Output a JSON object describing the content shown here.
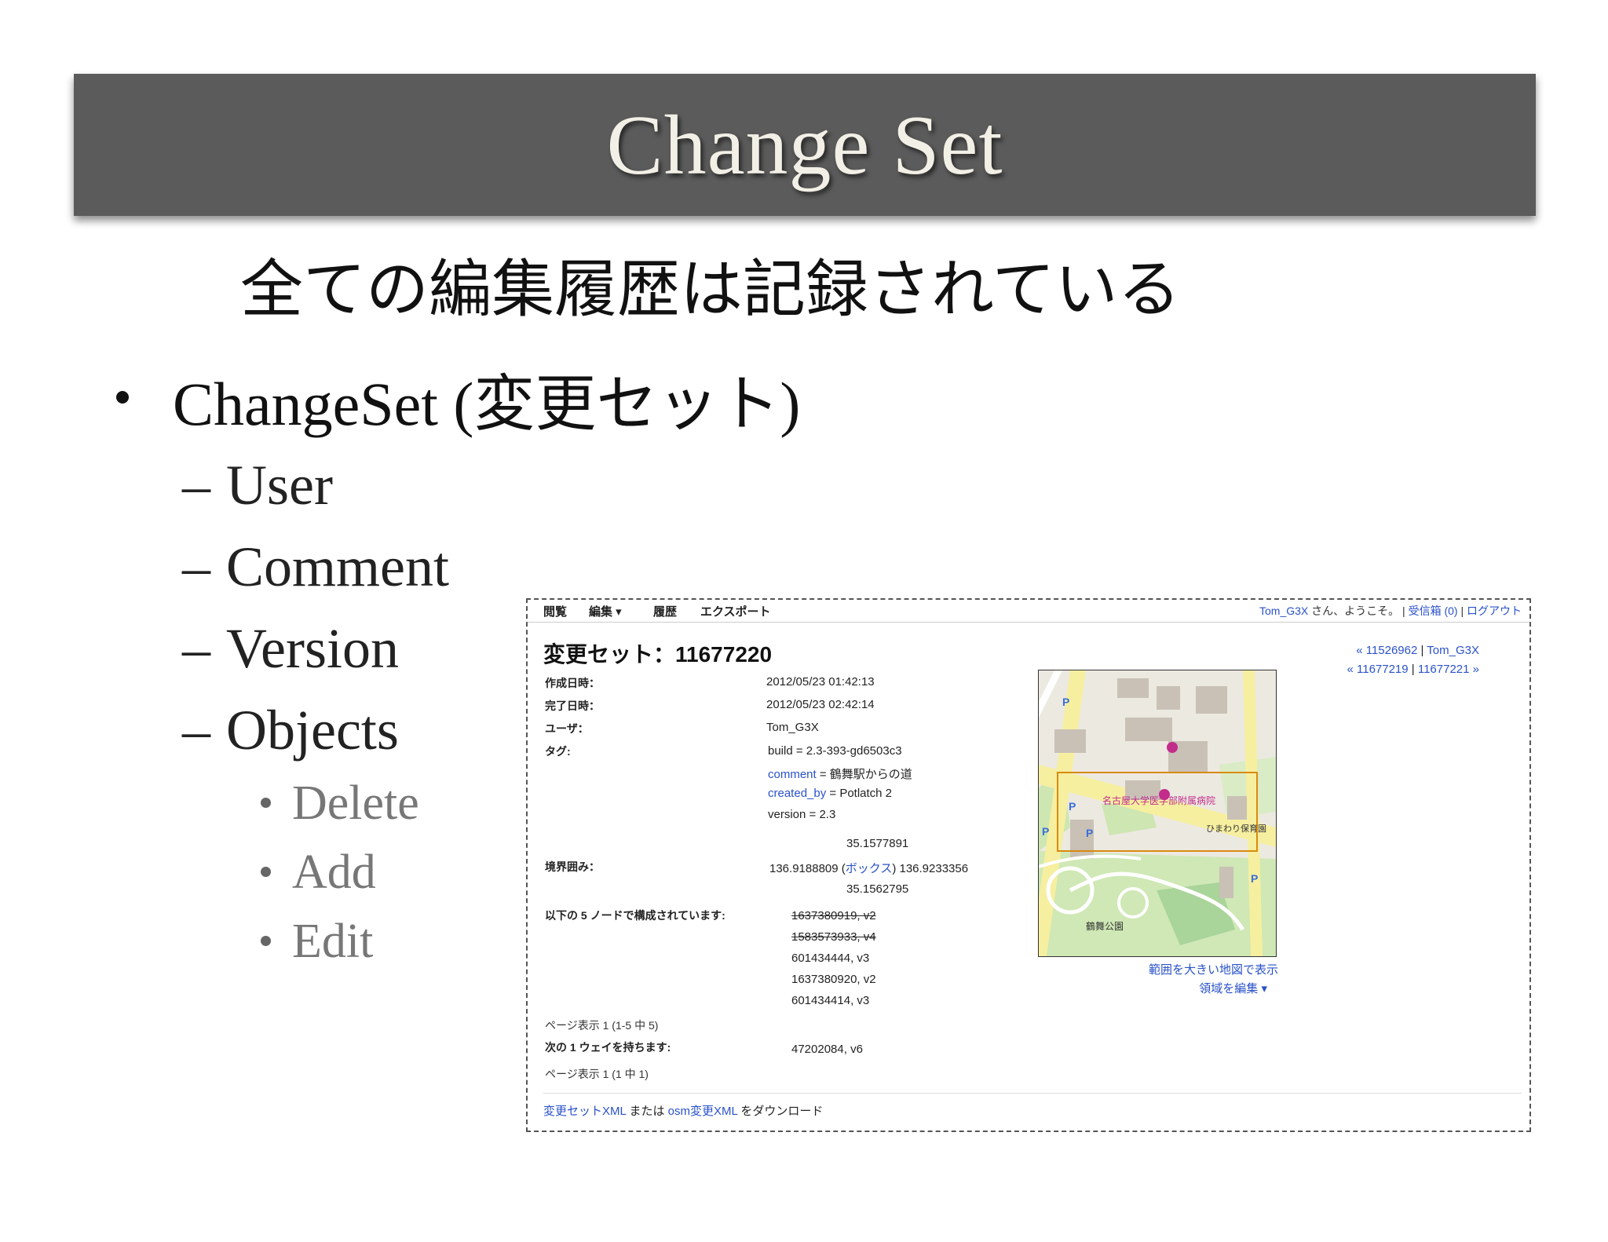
{
  "slide": {
    "title": "Change Set",
    "headline": "全ての編集履歴は記録されている",
    "bullet_main": "ChangeSet (変更セット)",
    "sub_items": [
      "User",
      "Comment",
      "Version",
      "Objects"
    ],
    "object_items": [
      "Delete",
      "Add",
      "Edit"
    ],
    "dash": "–"
  },
  "screenshot": {
    "nav": {
      "browse": "閲覧",
      "edit": "編集 ▾",
      "history": "履歴",
      "export": "エクスポート",
      "user_link": "Tom_G3X",
      "welcome": " さん、ようこそ。 | ",
      "inbox": "受信箱 (0)",
      "sep": " | ",
      "logout": "ログアウト"
    },
    "changeset_title": "変更セット：11677220",
    "prev_next": {
      "line1_link": "« 11526962",
      "line1_sep": " | ",
      "line1_user": "Tom_G3X",
      "line2_prev": "« 11677219",
      "line2_sep": " | ",
      "line2_next": "11677221 »"
    },
    "labels": {
      "created": "作成日時：",
      "closed": "完了日時：",
      "user": "ユーザ：",
      "tags": "タグ:",
      "bbox": "境界囲み：",
      "nodes": "以下の 5 ノードで構成されています:",
      "ways": "次の 1 ウェイを持ちます:"
    },
    "values": {
      "created": "2012/05/23 01:42:13",
      "closed": "2012/05/23 02:42:14",
      "user": "Tom_G3X"
    },
    "tags": {
      "build": "build = 2.3-393-gd6503c3",
      "comment_key": "comment",
      "comment_val": " = 鶴舞駅からの道",
      "created_by_key": "created_by",
      "created_by_val": " = Potlatch 2",
      "version": "version = 2.3"
    },
    "bbox": {
      "north": "35.1577891",
      "west": "136.9188809 (",
      "box_link": "ボックス",
      "east": ") 136.9233356",
      "south": "35.1562795"
    },
    "nodes": [
      {
        "text": "1637380919, v2",
        "deleted": true
      },
      {
        "text": "1583573933, v4",
        "deleted": true
      },
      {
        "text": "601434444, v3",
        "deleted": false
      },
      {
        "text": "1637380920, v2",
        "deleted": false
      },
      {
        "text": "601434414, v3",
        "deleted": false
      }
    ],
    "nodes_paging": "ページ表示 1 (1-5 中 5)",
    "ways": [
      "47202084, v6"
    ],
    "ways_paging": "ページ表示 1 (1 中 1)",
    "map": {
      "label_hospital": "名古屋大学医学部附属病院",
      "label_nursery": "ひまわり保育園",
      "label_park": "鶴舞公園",
      "view_larger": "範囲を大きい地図で表示",
      "edit_area": "領域を編集 ▾"
    },
    "footer": {
      "xml_link": "変更セットXML",
      "or": " または ",
      "osm_link": "osm変更XML",
      "download": " をダウンロード"
    }
  }
}
